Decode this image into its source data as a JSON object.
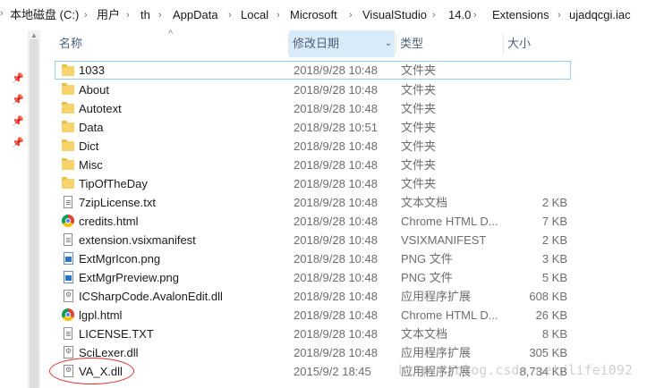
{
  "breadcrumb": {
    "items": [
      "本地磁盘 (C:)",
      "用户",
      "th",
      "AppData",
      "Local",
      "Microsoft",
      "VisualStudio",
      "14.0",
      "Extensions",
      "ujadqcgi.iac"
    ]
  },
  "columns": {
    "name": "名称",
    "date": "修改日期",
    "type": "类型",
    "size": "大小"
  },
  "files": [
    {
      "name": "1033",
      "date": "2018/9/28 10:48",
      "type": "文件夹",
      "size": "",
      "icon": "folder-icon"
    },
    {
      "name": "About",
      "date": "2018/9/28 10:48",
      "type": "文件夹",
      "size": "",
      "icon": "folder-icon"
    },
    {
      "name": "Autotext",
      "date": "2018/9/28 10:48",
      "type": "文件夹",
      "size": "",
      "icon": "folder-icon"
    },
    {
      "name": "Data",
      "date": "2018/9/28 10:51",
      "type": "文件夹",
      "size": "",
      "icon": "folder-icon"
    },
    {
      "name": "Dict",
      "date": "2018/9/28 10:48",
      "type": "文件夹",
      "size": "",
      "icon": "folder-icon"
    },
    {
      "name": "Misc",
      "date": "2018/9/28 10:48",
      "type": "文件夹",
      "size": "",
      "icon": "folder-icon"
    },
    {
      "name": "TipOfTheDay",
      "date": "2018/9/28 10:48",
      "type": "文件夹",
      "size": "",
      "icon": "folder-icon"
    },
    {
      "name": "7zipLicense.txt",
      "date": "2018/9/28 10:48",
      "type": "文本文档",
      "size": "2 KB",
      "icon": "text-file-icon"
    },
    {
      "name": "credits.html",
      "date": "2018/9/28 10:48",
      "type": "Chrome HTML D...",
      "size": "7 KB",
      "icon": "chrome-icon"
    },
    {
      "name": "extension.vsixmanifest",
      "date": "2018/9/28 10:48",
      "type": "VSIXMANIFEST",
      "size": "2 KB",
      "icon": "file-icon"
    },
    {
      "name": "ExtMgrIcon.png",
      "date": "2018/9/28 10:48",
      "type": "PNG 文件",
      "size": "3 KB",
      "icon": "png-file-icon"
    },
    {
      "name": "ExtMgrPreview.png",
      "date": "2018/9/28 10:48",
      "type": "PNG 文件",
      "size": "5 KB",
      "icon": "png-file-icon"
    },
    {
      "name": "ICSharpCode.AvalonEdit.dll",
      "date": "2018/9/28 10:48",
      "type": "应用程序扩展",
      "size": "608 KB",
      "icon": "dll-file-icon"
    },
    {
      "name": "lgpl.html",
      "date": "2018/9/28 10:48",
      "type": "Chrome HTML D...",
      "size": "26 KB",
      "icon": "chrome-icon"
    },
    {
      "name": "LICENSE.TXT",
      "date": "2018/9/28 10:48",
      "type": "文本文档",
      "size": "8 KB",
      "icon": "text-file-icon"
    },
    {
      "name": "SciLexer.dll",
      "date": "2018/9/28 10:48",
      "type": "应用程序扩展",
      "size": "305 KB",
      "icon": "dll-file-icon"
    },
    {
      "name": "VA_X.dll",
      "date": "2015/9/2 18:45",
      "type": "应用程序扩展",
      "size": "8,734 KB",
      "icon": "dll-file-icon"
    }
  ],
  "watermark": "http://blog.csdn.net/lifei092",
  "accent_color": "#d9ebf9",
  "highlight_color": "#e03030"
}
